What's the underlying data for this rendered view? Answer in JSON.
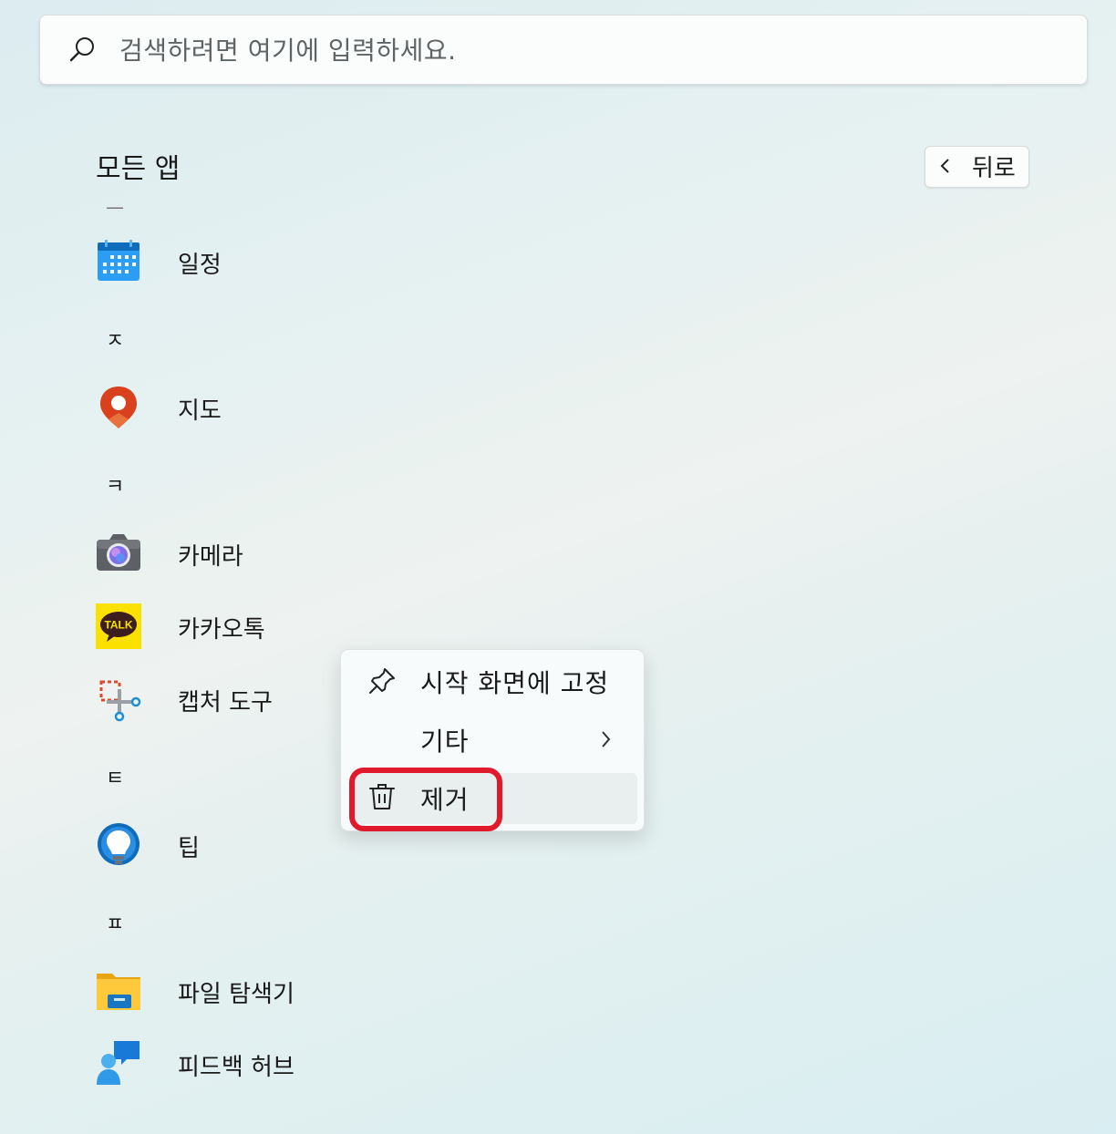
{
  "search": {
    "placeholder": "검색하려면 여기에 입력하세요."
  },
  "header": {
    "title": "모든 앱",
    "back_label": "뒤로"
  },
  "apps": [
    {
      "type": "letter",
      "label": "ㅡ"
    },
    {
      "type": "app",
      "label": "일정",
      "icon": "calendar-icon"
    },
    {
      "type": "letter",
      "label": "ㅈ"
    },
    {
      "type": "app",
      "label": "지도",
      "icon": "maps-icon"
    },
    {
      "type": "letter",
      "label": "ㅋ"
    },
    {
      "type": "app",
      "label": "카메라",
      "icon": "camera-icon"
    },
    {
      "type": "app",
      "label": "카카오톡",
      "icon": "kakaotalk-icon"
    },
    {
      "type": "app",
      "label": "캡처 도구",
      "icon": "snipping-tool-icon"
    },
    {
      "type": "letter",
      "label": "ㅌ"
    },
    {
      "type": "app",
      "label": "팁",
      "icon": "tips-icon"
    },
    {
      "type": "letter",
      "label": "ㅍ"
    },
    {
      "type": "app",
      "label": "파일 탐색기",
      "icon": "file-explorer-icon"
    },
    {
      "type": "app",
      "label": "피드백 허브",
      "icon": "feedback-hub-icon"
    }
  ],
  "kakao_badge": "TALK",
  "context_menu": {
    "items": [
      {
        "label": "시작 화면에 고정",
        "icon": "pin-icon"
      },
      {
        "label": "기타",
        "icon": "chevron-right-icon"
      },
      {
        "label": "제거",
        "icon": "trash-icon"
      }
    ]
  },
  "colors": {
    "highlight": "#e01a2b",
    "accent": "#0078d4"
  }
}
